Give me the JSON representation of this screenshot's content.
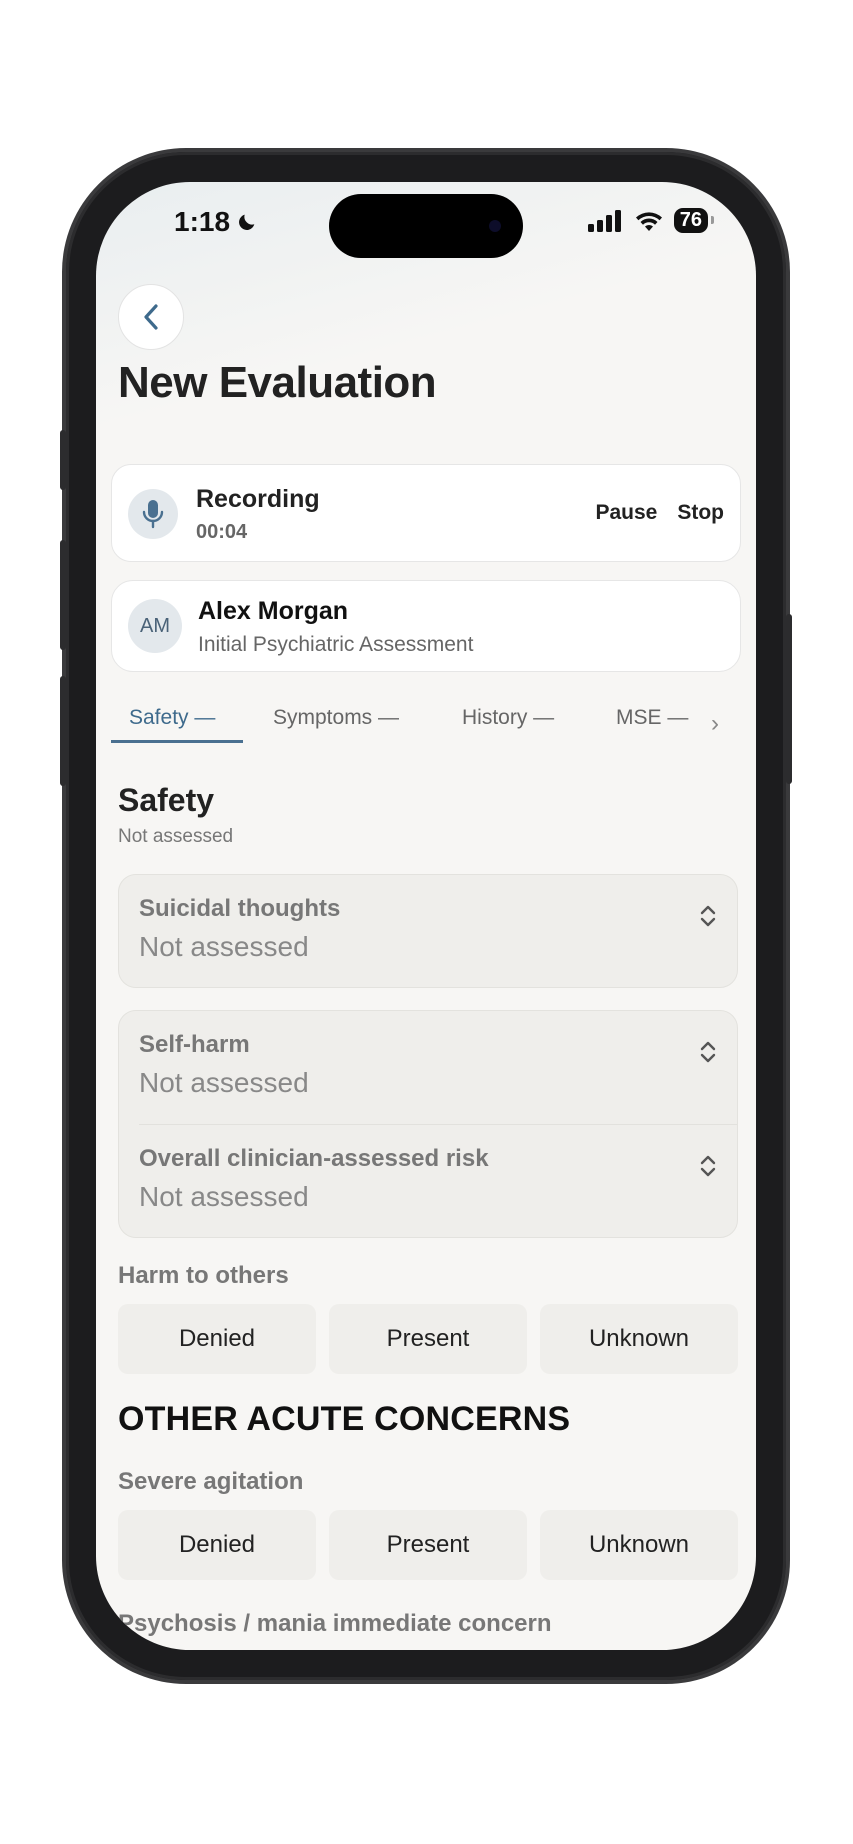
{
  "status_bar": {
    "time": "1:18",
    "battery": "76"
  },
  "header": {
    "title": "New Evaluation"
  },
  "recording": {
    "label": "Recording",
    "elapsed": "00:04",
    "pause_label": "Pause",
    "stop_label": "Stop"
  },
  "patient": {
    "initials": "AM",
    "name": "Alex Morgan",
    "assessment": "Initial Psychiatric Assessment"
  },
  "tabs": [
    {
      "label": "Safety —",
      "active": true
    },
    {
      "label": "Symptoms —",
      "active": false
    },
    {
      "label": "History —",
      "active": false
    },
    {
      "label": "MSE —",
      "active": false
    }
  ],
  "section": {
    "title": "Safety",
    "status": "Not assessed"
  },
  "selects": {
    "suicidal": {
      "label": "Suicidal thoughts",
      "value": "Not assessed"
    },
    "self_harm": {
      "label": "Self-harm",
      "value": "Not assessed"
    },
    "overall_risk": {
      "label": "Overall clinician-assessed risk",
      "value": "Not assessed"
    }
  },
  "harm_to_others": {
    "label": "Harm to others",
    "options": [
      "Denied",
      "Present",
      "Unknown"
    ]
  },
  "other_concerns": {
    "heading": "OTHER ACUTE CONCERNS",
    "severe_agitation": {
      "label": "Severe agitation",
      "options": [
        "Denied",
        "Present",
        "Unknown"
      ]
    },
    "psychosis_label": "Psychosis / mania immediate concern"
  },
  "colors": {
    "accent": "#3e6a8c",
    "segment_bg": "#efeeeb",
    "card_bg": "#ffffff"
  }
}
